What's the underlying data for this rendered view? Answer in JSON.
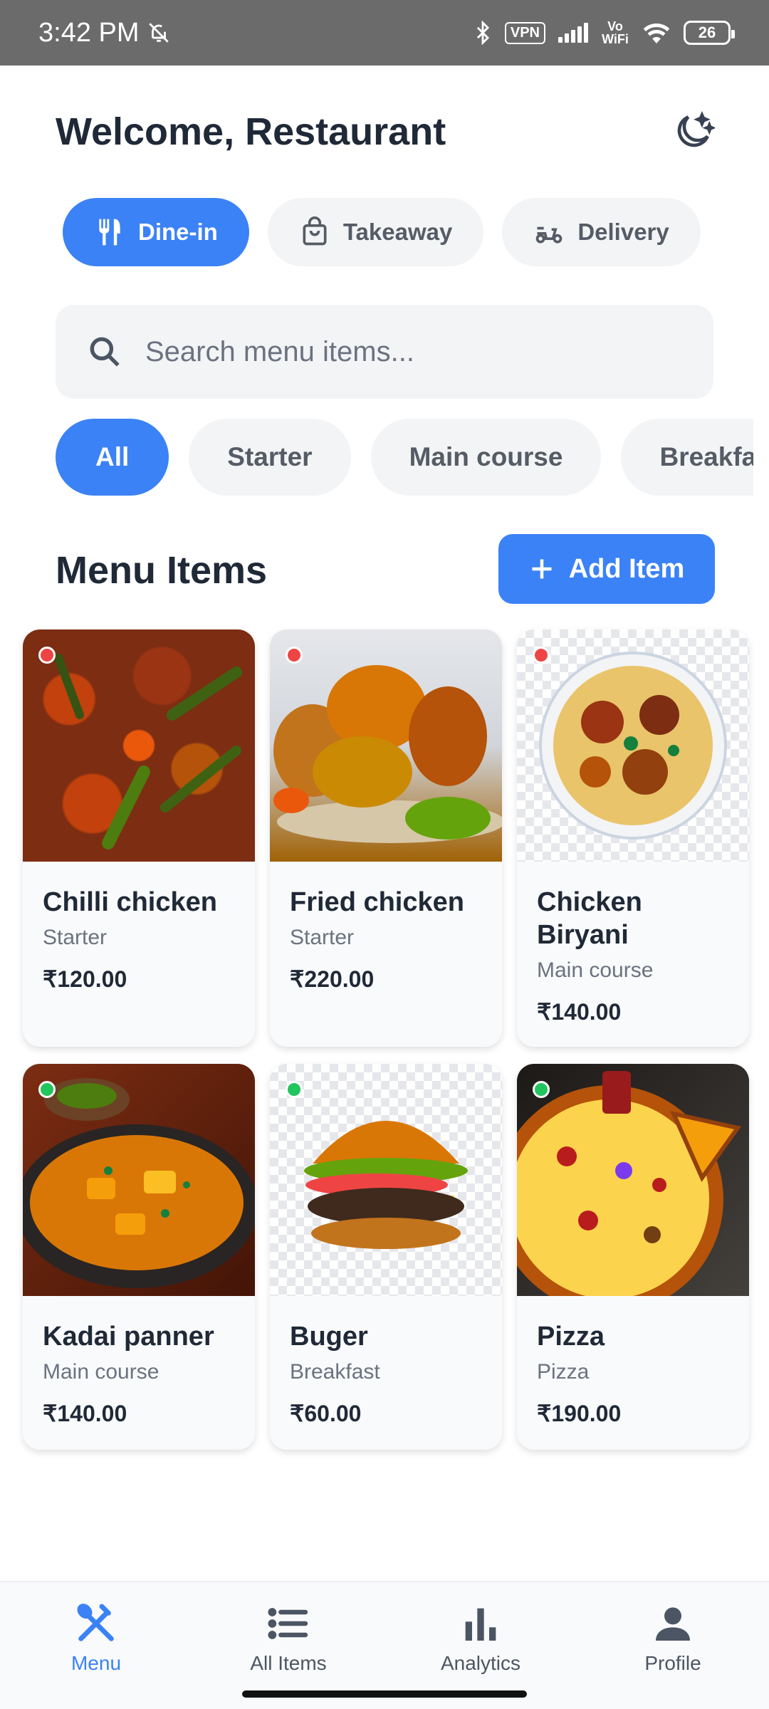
{
  "status_bar": {
    "time": "3:42 PM",
    "vpn": "VPN",
    "network": "Vo WiFi",
    "battery": "26"
  },
  "header": {
    "title": "Welcome, Restaurant",
    "theme_icon": "moon-stars-icon"
  },
  "order_types": [
    {
      "label": "Dine-in",
      "icon": "utensils-icon",
      "active": true
    },
    {
      "label": "Takeaway",
      "icon": "shopping-bag-icon",
      "active": false
    },
    {
      "label": "Delivery",
      "icon": "scooter-icon",
      "active": false
    }
  ],
  "search": {
    "placeholder": "Search menu items..."
  },
  "categories": [
    {
      "label": "All",
      "active": true
    },
    {
      "label": "Starter",
      "active": false
    },
    {
      "label": "Main course",
      "active": false
    },
    {
      "label": "Breakfast",
      "active": false
    }
  ],
  "menu": {
    "title": "Menu Items",
    "add_label": "Add Item",
    "items": [
      {
        "name": "Chilli chicken",
        "category": "Starter",
        "price": "₹120.00",
        "veg": false
      },
      {
        "name": "Fried chicken",
        "category": "Starter",
        "price": "₹220.00",
        "veg": false
      },
      {
        "name": "Chicken Biryani",
        "category": "Main course",
        "price": "₹140.00",
        "veg": false
      },
      {
        "name": "Kadai panner",
        "category": "Main course",
        "price": "₹140.00",
        "veg": true
      },
      {
        "name": "Buger",
        "category": "Breakfast",
        "price": "₹60.00",
        "veg": true
      },
      {
        "name": "Pizza",
        "category": "Pizza",
        "price": "₹190.00",
        "veg": true
      }
    ]
  },
  "bottom_nav": [
    {
      "label": "Menu",
      "active": true
    },
    {
      "label": "All Items",
      "active": false
    },
    {
      "label": "Analytics",
      "active": false
    },
    {
      "label": "Profile",
      "active": false
    }
  ],
  "colors": {
    "accent": "#3b82f6",
    "nonveg_dot": "#ef4444",
    "veg_dot": "#22c55e"
  }
}
